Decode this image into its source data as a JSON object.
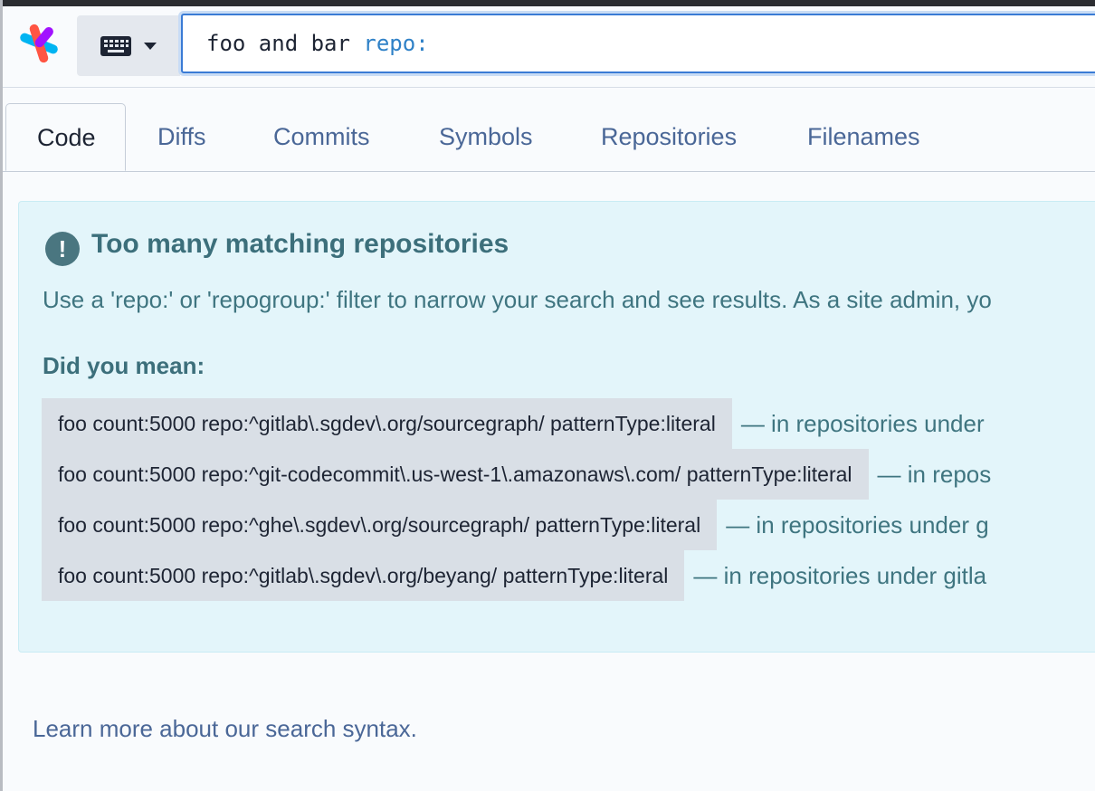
{
  "search": {
    "query_text": "foo and bar ",
    "filter_text": "repo:"
  },
  "icons": {
    "logo": "sourcegraph-logo",
    "keyboard": "keyboard-icon",
    "dropdown": "caret-down-icon",
    "alert": "exclamation-circle-icon"
  },
  "tabs": [
    {
      "label": "Code",
      "active": true
    },
    {
      "label": "Diffs",
      "active": false
    },
    {
      "label": "Commits",
      "active": false
    },
    {
      "label": "Symbols",
      "active": false
    },
    {
      "label": "Repositories",
      "active": false
    },
    {
      "label": "Filenames",
      "active": false
    }
  ],
  "alert": {
    "icon_glyph": "!",
    "title": "Too many matching repositories",
    "description": "Use a 'repo:' or 'repogroup:' filter to narrow your search and see results. As a site admin, yo",
    "did_you_mean_label": "Did you mean:",
    "suggestions": [
      {
        "query": "foo count:5000 repo:^gitlab\\.sgdev\\.org/sourcegraph/ patternType:literal",
        "description": "— in repositories under"
      },
      {
        "query": "foo count:5000 repo:^git-codecommit\\.us-west-1\\.amazonaws\\.com/ patternType:literal",
        "description": "— in repos"
      },
      {
        "query": "foo count:5000 repo:^ghe\\.sgdev\\.org/sourcegraph/ patternType:literal",
        "description": "— in repositories under g"
      },
      {
        "query": "foo count:5000 repo:^gitlab\\.sgdev\\.org/beyang/ patternType:literal",
        "description": "— in repositories under gitla"
      }
    ]
  },
  "footer": {
    "learn_more": "Learn more about our search syntax."
  },
  "colors": {
    "accent": "#3a7bd5",
    "link": "#4a6797",
    "alert_bg": "#e3f5fa",
    "alert_text": "#3c6f7b"
  }
}
